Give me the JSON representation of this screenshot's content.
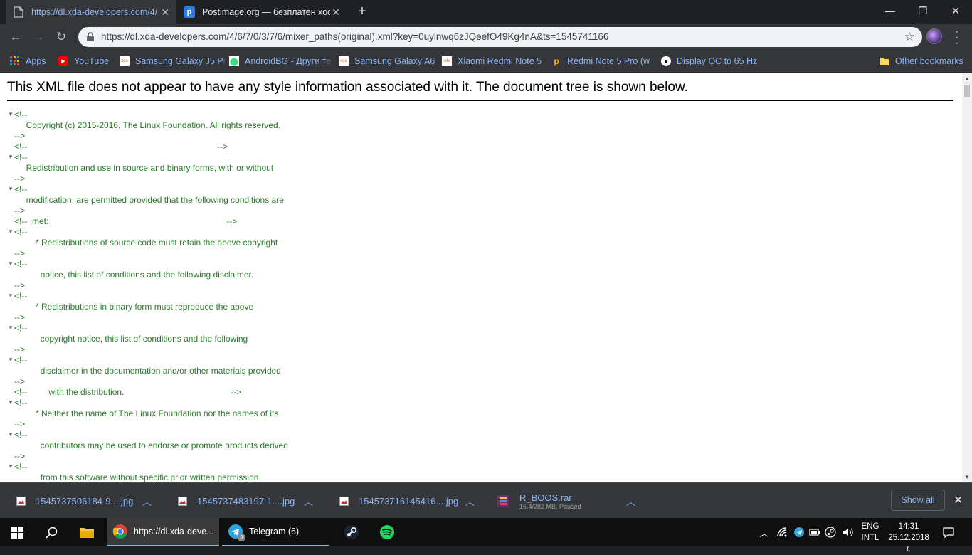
{
  "tabs": [
    {
      "title": "https://dl.xda-developers.com/4/6/7/0/3/7/6/",
      "active": true
    },
    {
      "title": "Postimage.org — безплатен хостинг",
      "active": false
    }
  ],
  "address_bar": {
    "url": "https://dl.xda-developers.com/4/6/7/0/3/7/6/mixer_paths(original).xml?key=0uylnwq6zJQeefO49Kg4nA&ts=1545741166"
  },
  "bookmarks": [
    {
      "label": "Apps"
    },
    {
      "label": "YouTube"
    },
    {
      "label": "Samsung Galaxy J5 P",
      "faded": "r"
    },
    {
      "label": "AndroidBG - Други т",
      "faded": "e"
    },
    {
      "label": "Samsung Galaxy A6"
    },
    {
      "label": "Xiaomi Redmi Note 5",
      "faded": ""
    },
    {
      "label": "Redmi Note 5 Pro (w",
      "faded": ""
    },
    {
      "label": "Display OC to 65 Hz",
      "faded": ""
    },
    {
      "label": "Other bookmarks"
    }
  ],
  "page": {
    "notice": "This XML file does not appear to have any style information associated with it. The document tree is shown below.",
    "lines": [
      {
        "text": "<!--",
        "tri": true
      },
      {
        "text": "     Copyright (c) 2015-2016, The Linux Foundation. All rights reserved."
      },
      {
        "text": "-->"
      },
      {
        "text": "<!--                                                                                -->"
      },
      {
        "text": "<!--",
        "tri": true
      },
      {
        "text": "     Redistribution and use in source and binary forms, with or without"
      },
      {
        "text": "-->"
      },
      {
        "text": "<!--",
        "tri": true
      },
      {
        "text": "     modification, are permitted provided that the following conditions are"
      },
      {
        "text": "-->"
      },
      {
        "text": "<!--  met:                                                                           -->"
      },
      {
        "text": "<!--",
        "tri": true
      },
      {
        "text": "         * Redistributions of source code must retain the above copyright"
      },
      {
        "text": "-->"
      },
      {
        "text": "<!--",
        "tri": true
      },
      {
        "text": "           notice, this list of conditions and the following disclaimer."
      },
      {
        "text": "-->"
      },
      {
        "text": "<!--",
        "tri": true
      },
      {
        "text": "         * Redistributions in binary form must reproduce the above"
      },
      {
        "text": "-->"
      },
      {
        "text": "<!--",
        "tri": true
      },
      {
        "text": "           copyright notice, this list of conditions and the following"
      },
      {
        "text": "-->"
      },
      {
        "text": "<!--",
        "tri": true
      },
      {
        "text": "           disclaimer in the documentation and/or other materials provided"
      },
      {
        "text": "-->"
      },
      {
        "text": "<!--         with the distribution.                                             -->"
      },
      {
        "text": "<!--",
        "tri": true
      },
      {
        "text": "         * Neither the name of The Linux Foundation nor the names of its"
      },
      {
        "text": "-->"
      },
      {
        "text": "<!--",
        "tri": true
      },
      {
        "text": "           contributors may be used to endorse or promote products derived"
      },
      {
        "text": "-->"
      },
      {
        "text": "<!--",
        "tri": true
      },
      {
        "text": "           from this software without specific prior written permission."
      }
    ]
  },
  "downloads": [
    {
      "name": "1545737506184-9....jpg"
    },
    {
      "name": "1545737483197-1....jpg"
    },
    {
      "name": "154573716145416....jpg"
    },
    {
      "name": "R_BOOS.rar",
      "status": "16.4/282 MB, Paused"
    }
  ],
  "downloads_show_all": "Show all",
  "taskbar": {
    "chrome_label": "https://dl.xda-deve...",
    "telegram_label": "Telegram (6)",
    "telegram_badge": "6",
    "lang_top": "ENG",
    "lang_bottom": "INTL",
    "time": "14:31",
    "date": "25.12.2018 г."
  },
  "colors": {
    "link": "#8ab4f8",
    "xml_comment": "#2a7a2a",
    "taskbar_bg": "#0f0f0f"
  }
}
